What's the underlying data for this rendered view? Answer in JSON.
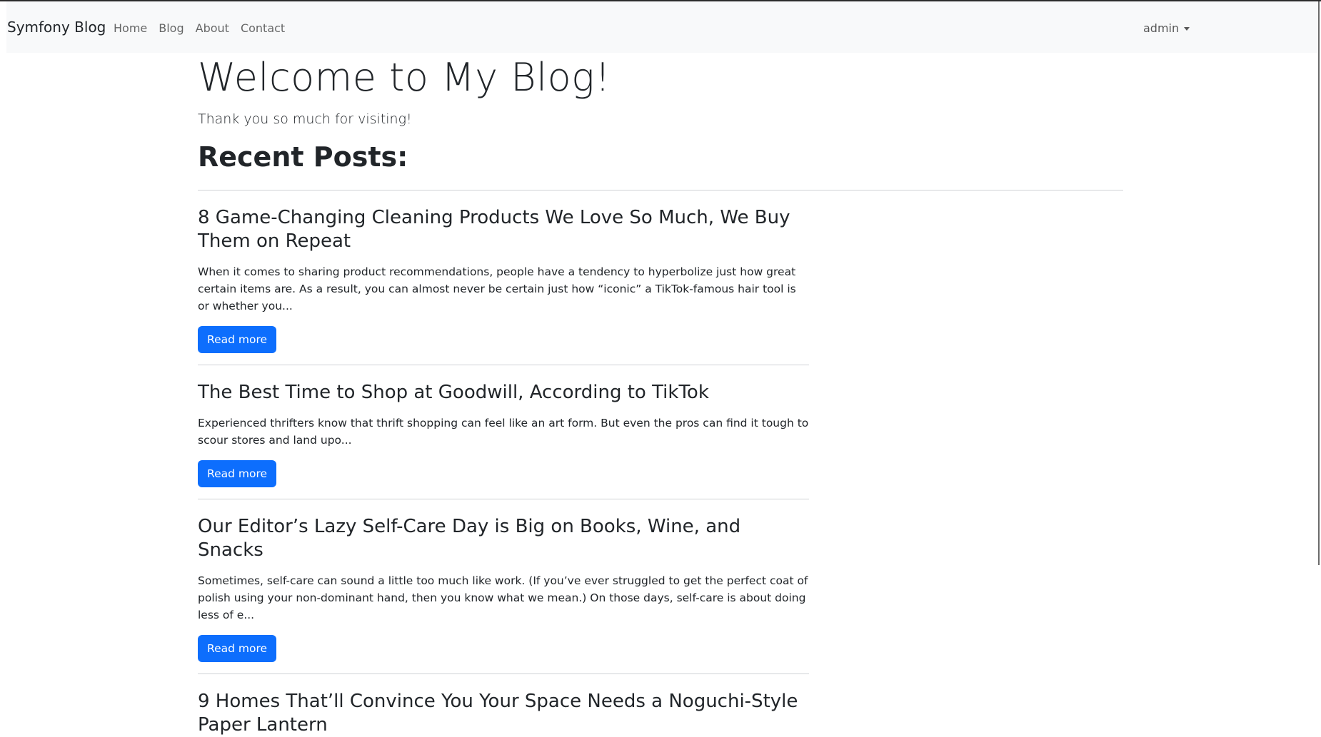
{
  "navbar": {
    "brand": "Symfony Blog",
    "links": [
      "Home",
      "Blog",
      "About",
      "Contact"
    ],
    "user": "admin"
  },
  "hero": {
    "title": "Welcome to My Blog!",
    "lead": "Thank you so much for visiting!"
  },
  "recent": {
    "heading": "Recent Posts:"
  },
  "posts": [
    {
      "title": "8 Game-Changing Cleaning Products We Love So Much, We Buy Them on Repeat",
      "excerpt": "When it comes to sharing product recommendations, people have a tendency to hyperbolize just how great certain items are. As a result, you can almost never be certain just how “iconic” a TikTok-famous hair tool is or whether you...",
      "button": "Read more"
    },
    {
      "title": "The Best Time to Shop at Goodwill, According to TikTok",
      "excerpt": "Experienced thrifters know that thrift shopping can feel like an art form. But even the pros can find it tough to scour stores and land upo...",
      "button": "Read more"
    },
    {
      "title": "Our Editor’s Lazy Self-Care Day is Big on Books, Wine, and Snacks",
      "excerpt": "Sometimes, self-care can sound a little too much like work. (If you’ve ever struggled to get the perfect coat of polish using your non-dominant hand, then you know what we mean.) On those days, self-care is about doing less of e...",
      "button": "Read more"
    },
    {
      "title": "9 Homes That’ll Convince You Your Space Needs a Noguchi-Style Paper Lantern"
    }
  ],
  "colors": {
    "primary": "#0d6efd",
    "navbar_bg": "#f8f9fa",
    "text": "#212529"
  }
}
